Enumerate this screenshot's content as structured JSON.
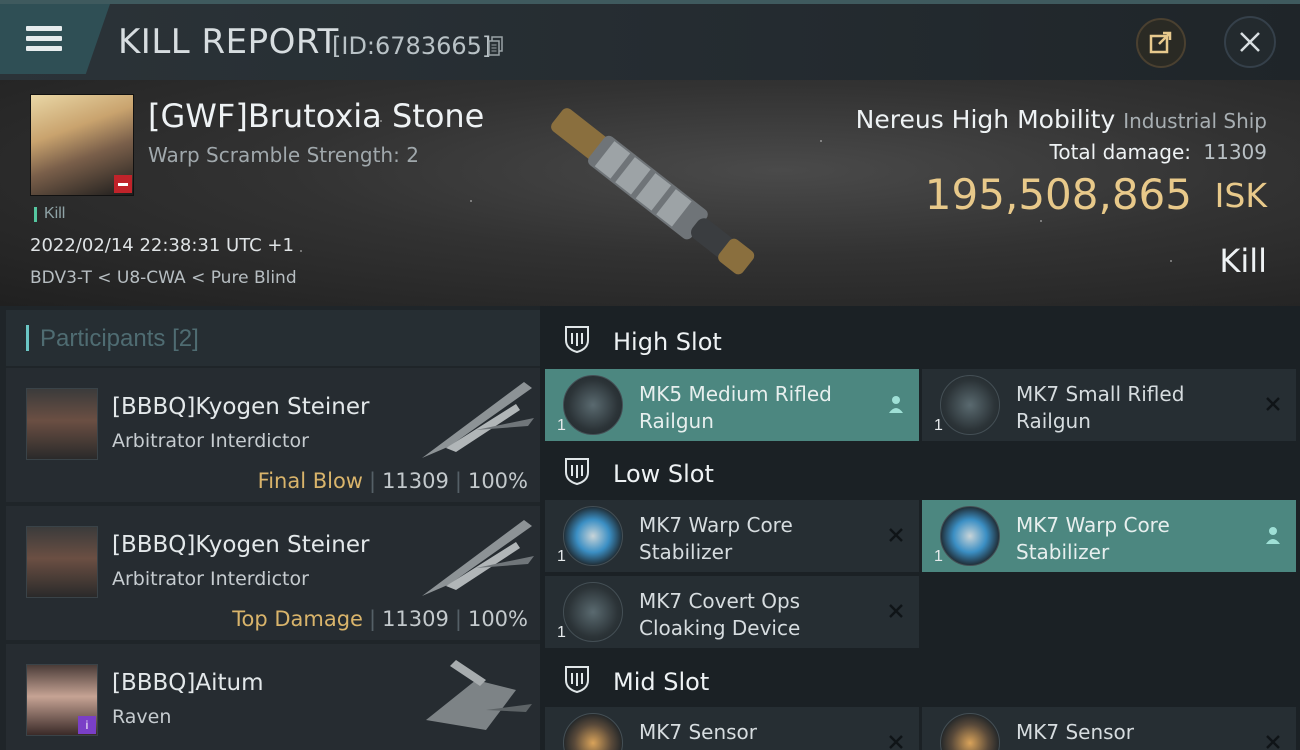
{
  "header": {
    "title": "KILL REPORT",
    "report_id": "[ID:6783665]"
  },
  "victim": {
    "name": "[GWF]Brutoxia Stone",
    "warp_scramble": "Warp Scramble Strength: 2",
    "kill_tag": "Kill",
    "datetime": "2022/02/14 22:38:31 UTC +1",
    "location": "BDV3-T < U8-CWA < Pure Blind"
  },
  "ship": {
    "name": "Nereus High Mobility",
    "class": "Industrial Ship",
    "total_damage_label": "Total damage:",
    "total_damage_value": "11309",
    "isk_value": "195,508,865",
    "isk_unit": "ISK",
    "result": "Kill"
  },
  "participants": {
    "title": "Participants",
    "count": "[2]",
    "rows": [
      {
        "name": "[BBBQ]Kyogen Steiner",
        "ship": "Arbitrator Interdictor",
        "role": "Final Blow",
        "damage": "11309",
        "percent": "100%"
      },
      {
        "name": "[BBBQ]Kyogen Steiner",
        "ship": "Arbitrator Interdictor",
        "role": "Top Damage",
        "damage": "11309",
        "percent": "100%"
      },
      {
        "name": "[BBBQ]Aitum",
        "ship": "Raven",
        "role": "",
        "damage": "",
        "percent": ""
      }
    ]
  },
  "slots": {
    "high": {
      "title": "High Slot",
      "items": [
        {
          "name": "MK5 Medium Rifled Railgun",
          "qty": "1",
          "state": "dropped"
        },
        {
          "name": "MK7 Small Rifled Railgun",
          "qty": "1",
          "state": "destroyed"
        }
      ]
    },
    "low": {
      "title": "Low Slot",
      "items": [
        {
          "name": "MK7 Warp Core Stabilizer",
          "qty": "1",
          "state": "destroyed"
        },
        {
          "name": "MK7 Warp Core Stabilizer",
          "qty": "1",
          "state": "dropped"
        },
        {
          "name": "MK7 Covert Ops Cloaking Device",
          "qty": "1",
          "state": "destroyed"
        }
      ]
    },
    "mid": {
      "title": "Mid Slot",
      "items": [
        {
          "name": "MK7 Sensor",
          "qty": "",
          "state": "destroyed"
        },
        {
          "name": "MK7 Sensor",
          "qty": "",
          "state": "destroyed"
        }
      ]
    }
  },
  "colors": {
    "isk": "#e8c98a",
    "dropped": "#4c8780",
    "accent": "#6bc6c5",
    "role": "#d9b46b"
  }
}
